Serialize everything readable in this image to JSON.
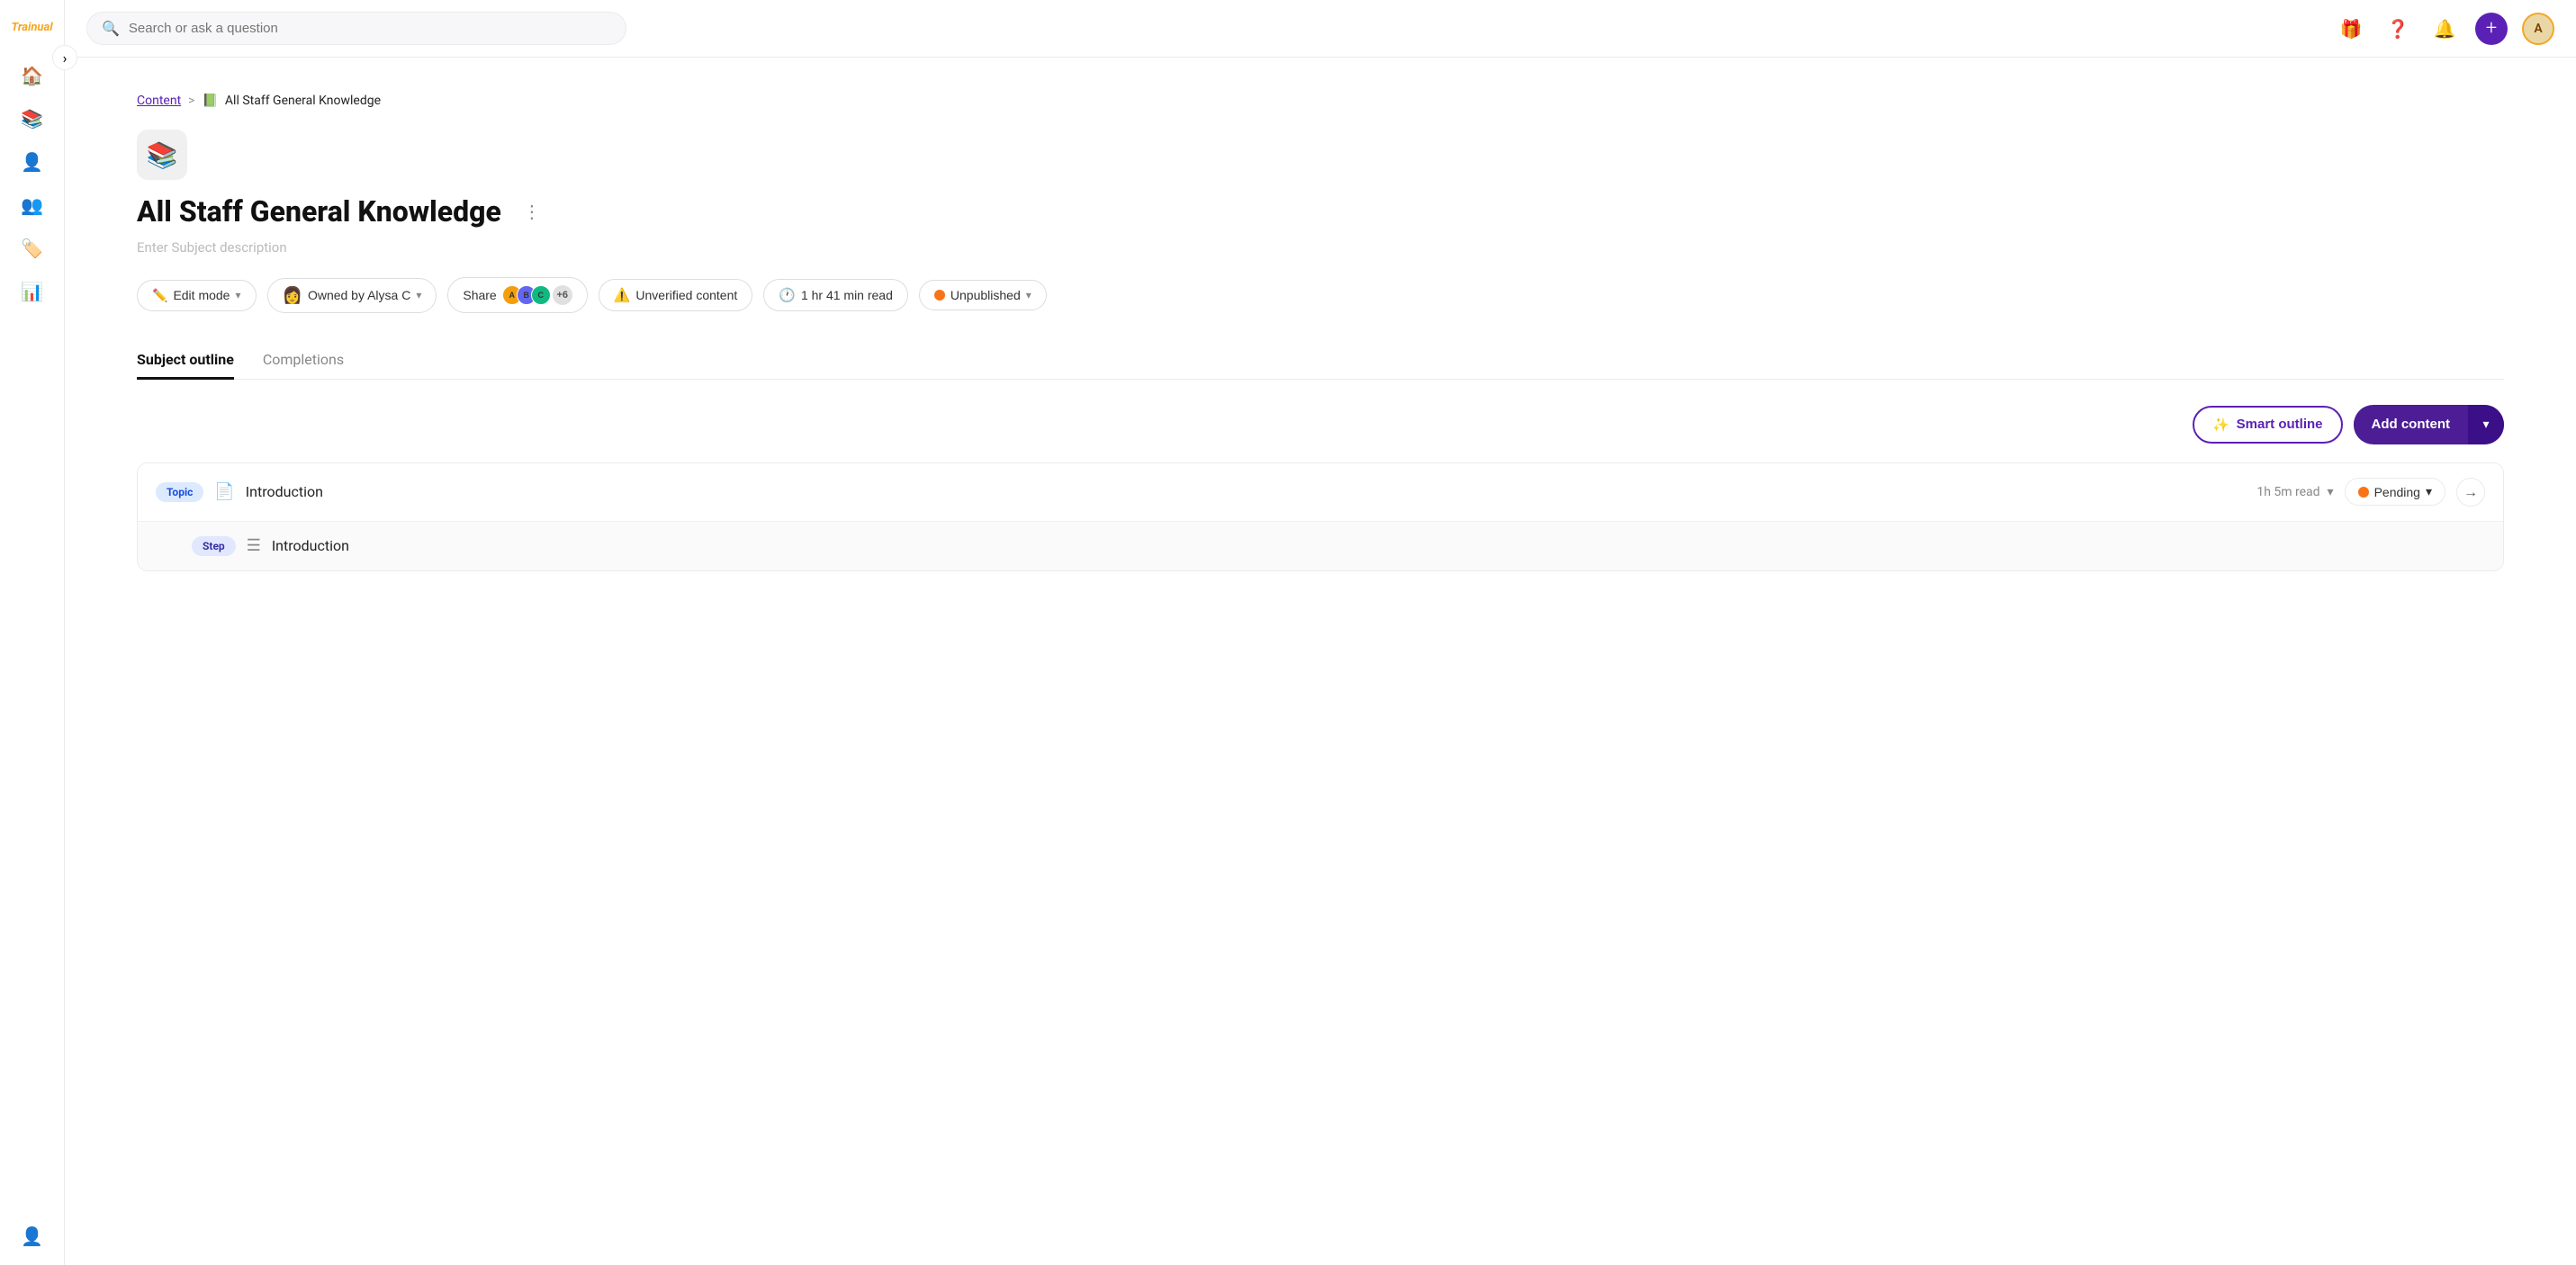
{
  "app": {
    "name": "Trainual",
    "logo_text": "Trainual"
  },
  "sidebar": {
    "items": [
      {
        "id": "home",
        "icon": "🏠",
        "label": "Home"
      },
      {
        "id": "library",
        "icon": "📚",
        "label": "Library"
      },
      {
        "id": "people",
        "icon": "👤",
        "label": "People"
      },
      {
        "id": "groups",
        "icon": "👥",
        "label": "Groups"
      },
      {
        "id": "tags",
        "icon": "🏷️",
        "label": "Tags"
      },
      {
        "id": "reports",
        "icon": "📊",
        "label": "Reports"
      },
      {
        "id": "profile",
        "icon": "👤",
        "label": "Profile"
      }
    ]
  },
  "topnav": {
    "search_placeholder": "Search or ask a question",
    "gift_icon": "🎁",
    "help_icon": "❓",
    "bell_icon": "🔔",
    "add_icon": "+",
    "avatar_initials": "A"
  },
  "breadcrumb": {
    "parent_label": "Content",
    "separator": ">",
    "emoji": "📗",
    "current_label": "All Staff General Knowledge"
  },
  "subject": {
    "icon": "📚",
    "title": "All Staff General Knowledge",
    "description_placeholder": "Enter Subject description",
    "more_icon": "⋮"
  },
  "action_bar": {
    "edit_mode_label": "Edit mode",
    "owner_label": "Owned by Alysa C",
    "share_label": "Share",
    "share_count": "+6",
    "unverified_label": "Unverified content",
    "read_time": "1 hr 41 min read",
    "publish_label": "Unpublished"
  },
  "tabs": [
    {
      "id": "subject-outline",
      "label": "Subject outline",
      "active": true
    },
    {
      "id": "completions",
      "label": "Completions",
      "active": false
    }
  ],
  "outline_toolbar": {
    "smart_outline_label": "Smart outline",
    "smart_outline_icon": "✨",
    "add_content_label": "Add content",
    "add_content_chevron": "▾"
  },
  "content_items": [
    {
      "type": "topic",
      "badge_label": "Topic",
      "icon": "📄",
      "title": "Introduction",
      "read_time": "1h 5m read",
      "status": "Pending",
      "status_color": "#f97316",
      "has_arrow": true,
      "steps": [
        {
          "type": "step",
          "badge_label": "Step",
          "icon": "≡",
          "title": "Introduction"
        }
      ]
    }
  ],
  "colors": {
    "primary": "#5b21b6",
    "primary_dark": "#4c1d95",
    "accent_orange": "#f97316",
    "border": "#ebebeb"
  }
}
